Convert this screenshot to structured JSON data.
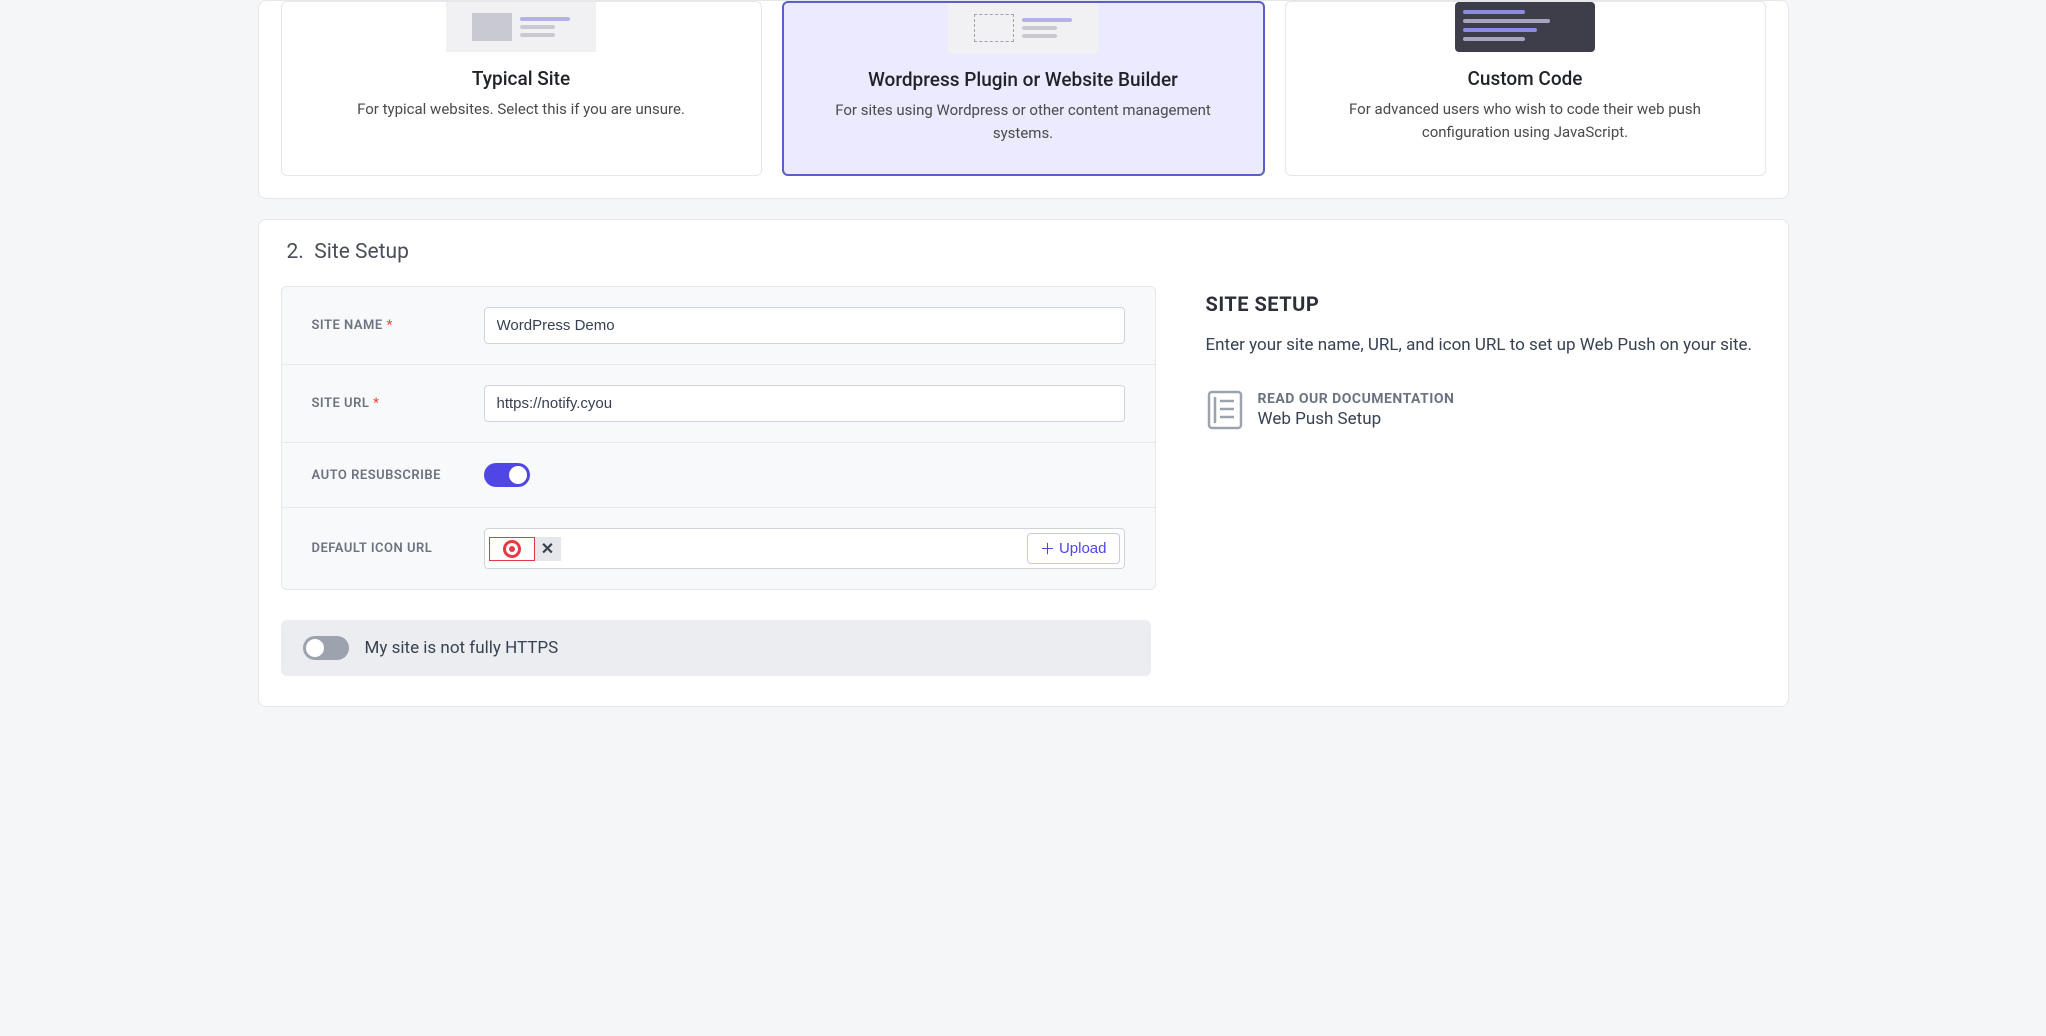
{
  "options": {
    "typical": {
      "title": "Typical Site",
      "desc": "For typical websites. Select this if you are unsure."
    },
    "wordpress": {
      "title": "Wordpress Plugin or Website Builder",
      "desc": "For sites using Wordpress or other content management systems."
    },
    "custom": {
      "title": "Custom Code",
      "desc": "For advanced users who wish to code their web push configuration using JavaScript."
    }
  },
  "section": {
    "number": "2.",
    "title": "Site Setup"
  },
  "form": {
    "site_name": {
      "label": "SITE NAME",
      "value": "WordPress Demo"
    },
    "site_url": {
      "label": "SITE URL",
      "value": "https://notify.cyou"
    },
    "auto_resubscribe": {
      "label": "AUTO RESUBSCRIBE",
      "on": true
    },
    "default_icon": {
      "label": "DEFAULT ICON URL",
      "upload": "Upload"
    }
  },
  "side": {
    "title": "SITE SETUP",
    "desc": "Enter your site name, URL, and icon URL to set up Web Push on your site.",
    "doc_label": "READ OUR DOCUMENTATION",
    "doc_title": "Web Push Setup"
  },
  "https": {
    "label": "My site is not fully HTTPS",
    "on": false
  }
}
